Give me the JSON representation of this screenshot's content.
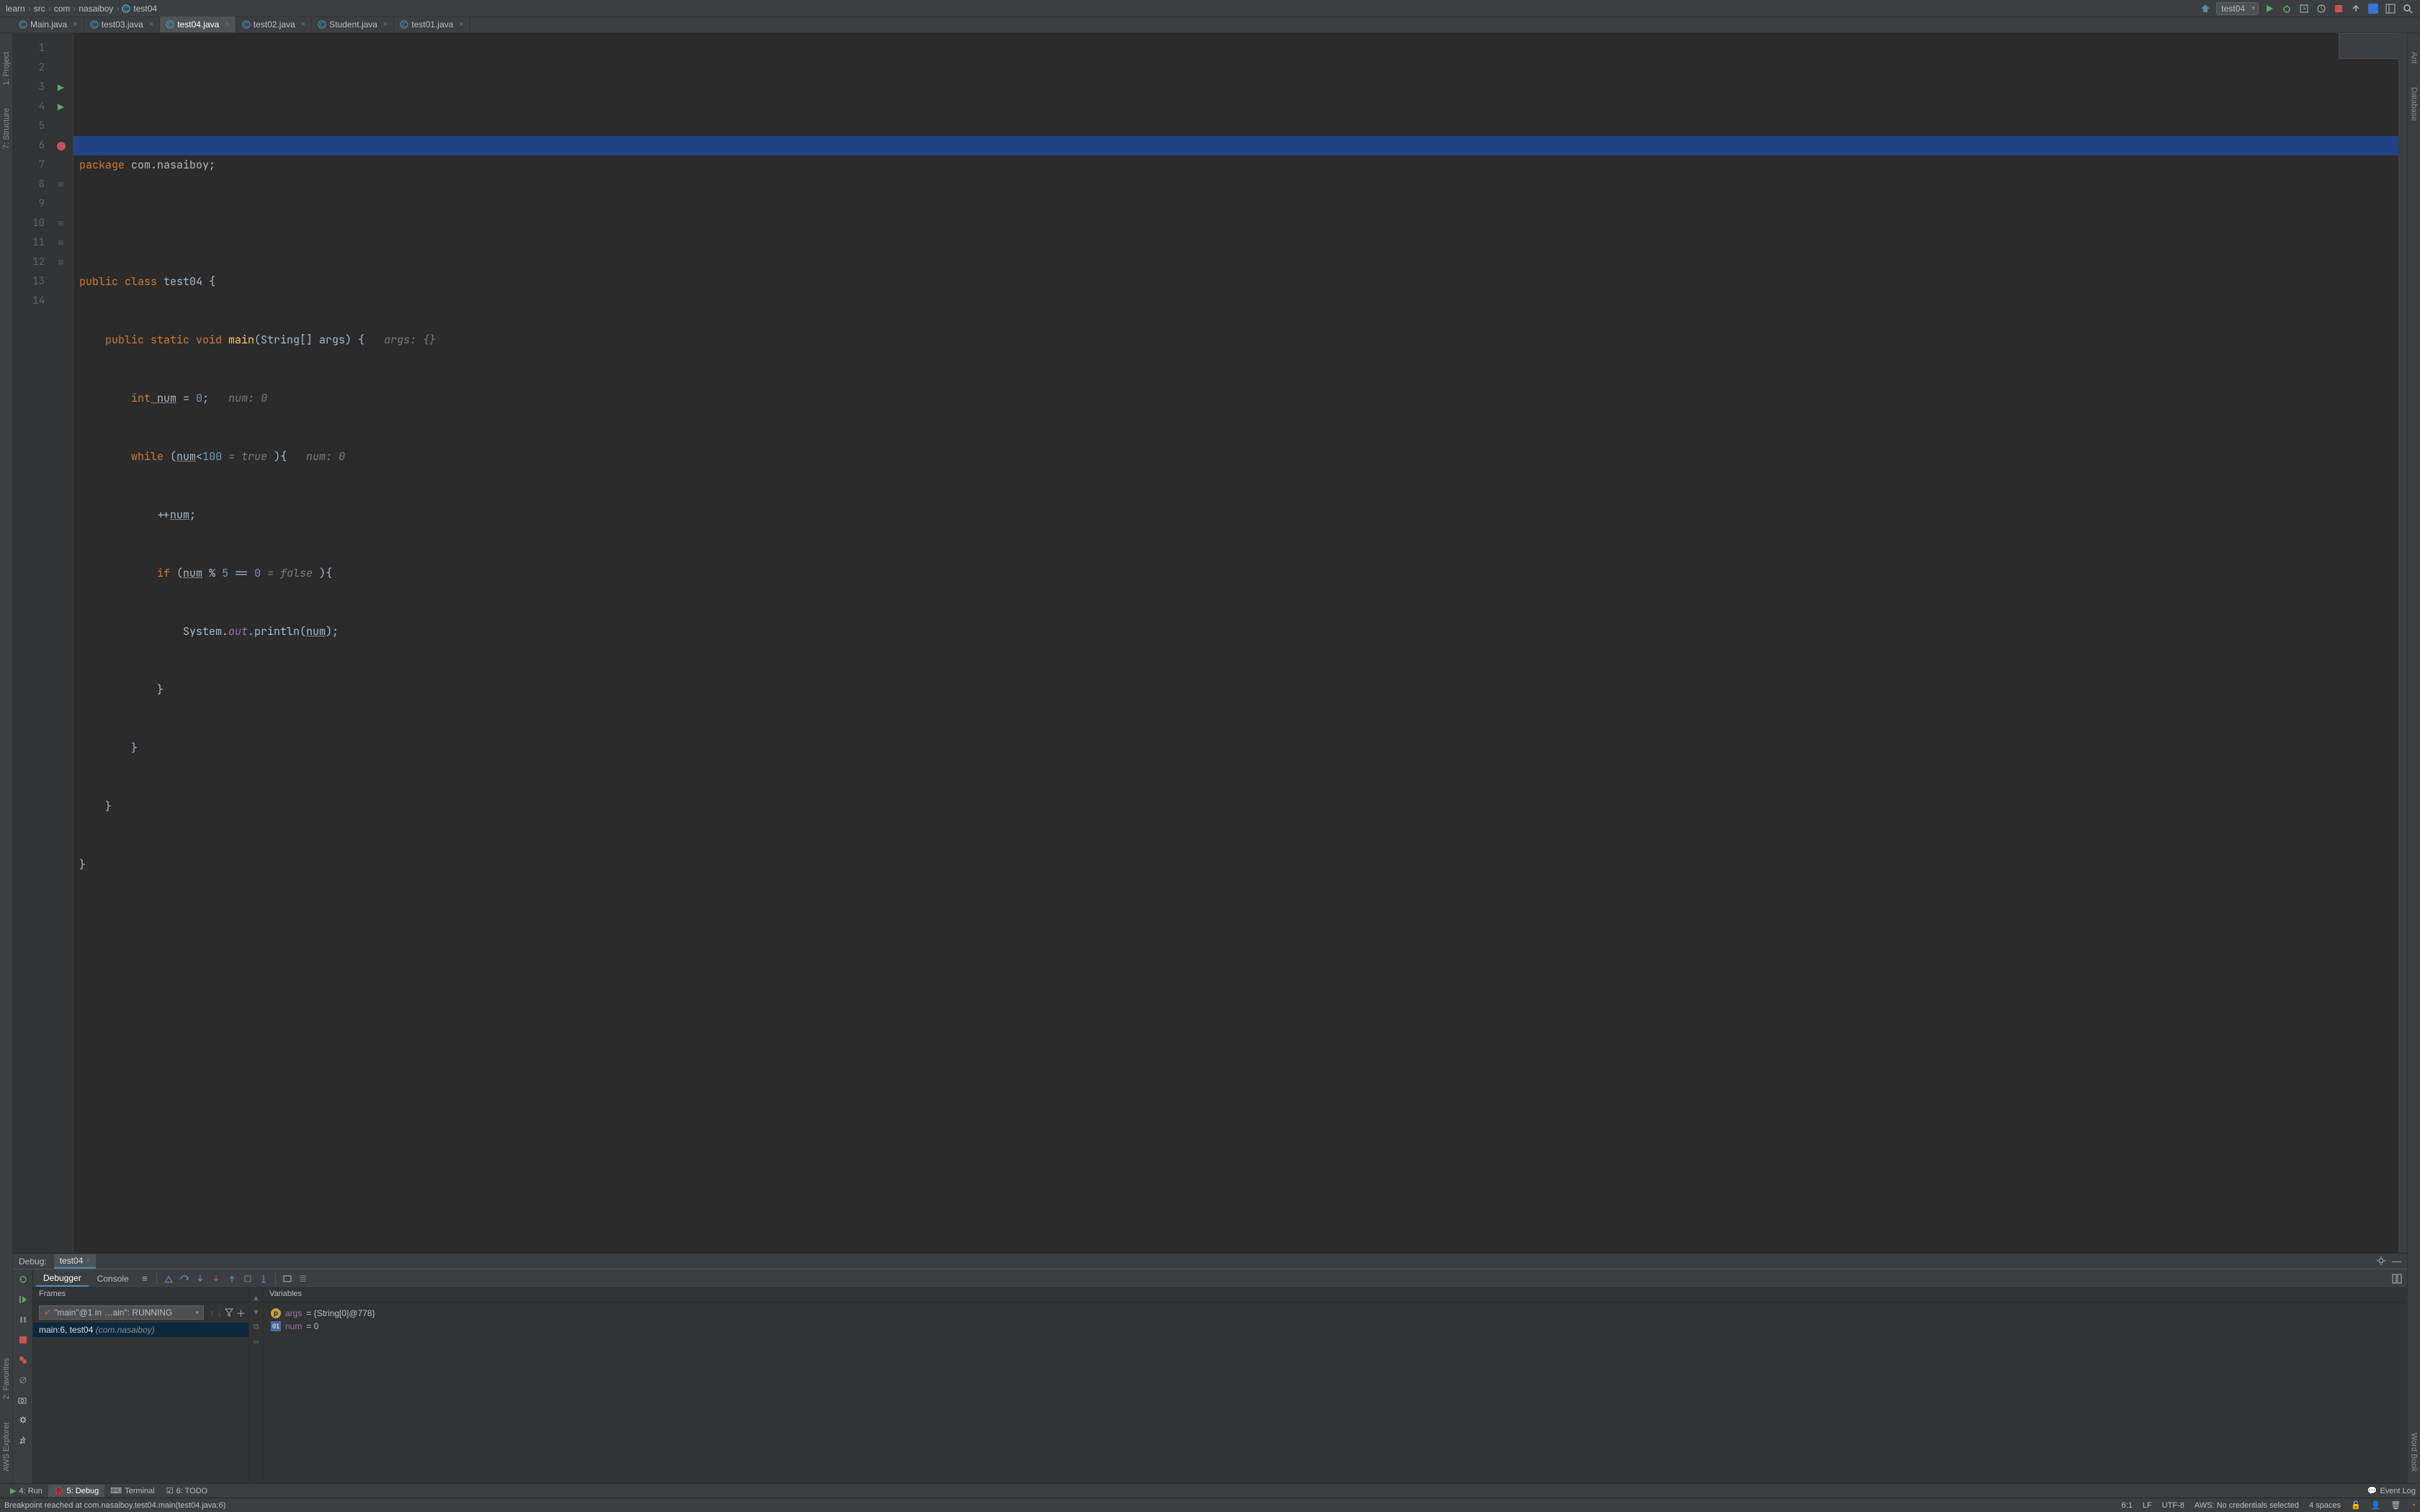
{
  "breadcrumb": {
    "items": [
      "learn",
      "src",
      "com",
      "nasaiboy",
      "test04"
    ]
  },
  "run_config": {
    "label": "test04"
  },
  "tabs": [
    {
      "label": "Main.java"
    },
    {
      "label": "test03.java"
    },
    {
      "label": "test04.java",
      "active": true
    },
    {
      "label": "test02.java"
    },
    {
      "label": "Student.java"
    },
    {
      "label": "test01.java"
    }
  ],
  "left_rail": [
    "1: Project",
    "7: Structure",
    "2: Favorites",
    "AWS Explorer"
  ],
  "right_rail": [
    "Ant",
    "Database",
    "Word Book"
  ],
  "code": {
    "lines": [
      {
        "num": "1"
      },
      {
        "num": "2"
      },
      {
        "num": "3"
      },
      {
        "num": "4"
      },
      {
        "num": "5"
      },
      {
        "num": "6"
      },
      {
        "num": "7"
      },
      {
        "num": "8"
      },
      {
        "num": "9"
      },
      {
        "num": "10"
      },
      {
        "num": "11"
      },
      {
        "num": "12"
      },
      {
        "num": "13"
      },
      {
        "num": "14"
      }
    ],
    "l1_kw": "package",
    "l1_pkg": " com.nasaiboy;",
    "l3_full": "public class ",
    "l3_name": "test04",
    "l3_brace": " {",
    "l4_full": "public static void ",
    "l4_name": "main",
    "l4_args": "(String[] args) {   ",
    "l4_hint": "args: {}",
    "l5_kw": "int",
    "l5_name": " num",
    "l5_eq": " = ",
    "l5_val": "0",
    "l5_semi": ";",
    "l5_hint": "   num: 0",
    "l6_kw": "while",
    "l6_op": " (",
    "l6_var": "num",
    "l6_lt": "<",
    "l6_hun": "100",
    "l6_hint": " = true ",
    "l6_close": "){   ",
    "l6_hint2": "num: 0",
    "l7_pre": "++",
    "l7_var": "num",
    "l7_semi": ";",
    "l8_kw": "if",
    "l8_op": " (",
    "l8_var": "num",
    "l8_mod": " % ",
    "l8_five": "5",
    "l8_eq": " == ",
    "l8_zero": "0",
    "l8_hint": " = false ",
    "l8_close": "){",
    "l9_sys": "System.",
    "l9_out": "out",
    "l9_print": ".println(",
    "l9_num": "num",
    "l9_close": ");",
    "l10_brace": "}",
    "l11_brace": "}",
    "l12_brace": "}",
    "l13_brace": "}"
  },
  "debug": {
    "title": "Debug:",
    "tab": "test04",
    "subtabs": [
      "Debugger",
      "Console"
    ],
    "frames_title": "Frames",
    "thread": "\"main\"@1 in …ain\": RUNNING",
    "frame_row_main": "main:6, test04",
    "frame_row_pkg": " (com.nasaiboy)",
    "vars_title": "Variables",
    "var_args": {
      "name": "args",
      "val": " = {String[0]@778}"
    },
    "var_num": {
      "name": "num",
      "val": " = 0"
    }
  },
  "bottom_tabs": {
    "run": "4: Run",
    "debug": "5: Debug",
    "terminal": "Terminal",
    "todo": "6: TODO",
    "event_log": "Event Log"
  },
  "status": {
    "msg": "Breakpoint reached at com.nasaiboy.test04.main(test04.java:6)",
    "pos": "6:1",
    "lf": "LF",
    "enc": "UTF-8",
    "aws": "AWS: No credentials selected",
    "indent": "4 spaces"
  }
}
